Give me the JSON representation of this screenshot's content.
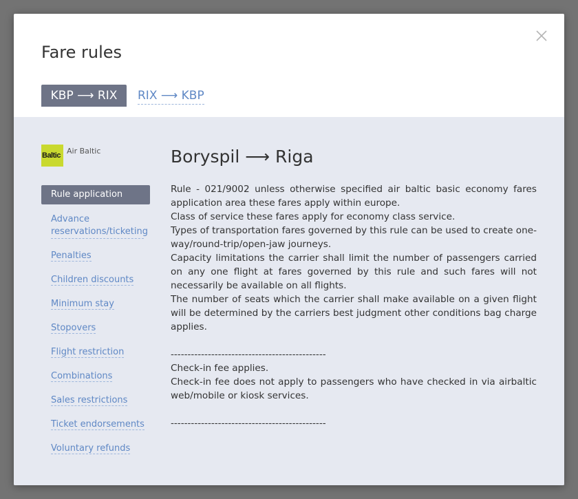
{
  "modal": {
    "title": "Fare rules",
    "close_icon": "close-icon"
  },
  "tabs": [
    {
      "label": "KBP ⟶ RIX",
      "active": true
    },
    {
      "label": "RIX ⟶ KBP",
      "active": false
    }
  ],
  "airline": {
    "logo_text": "Baltic",
    "name": "Air Baltic",
    "logo_color": "#c9d92f"
  },
  "rule_menu": [
    {
      "label": "Rule application",
      "active": true
    },
    {
      "label": "Advance reservations/ticketing"
    },
    {
      "label": "Penalties"
    },
    {
      "label": "Children discounts"
    },
    {
      "label": "Minimum stay"
    },
    {
      "label": "Stopovers"
    },
    {
      "label": "Flight restriction"
    },
    {
      "label": "Combinations"
    },
    {
      "label": "Sales restrictions"
    },
    {
      "label": "Ticket endorsements"
    },
    {
      "label": "Voluntary refunds"
    }
  ],
  "route_title": "Boryspil ⟶ Riga",
  "rule_lines": [
    "Rule - 021/9002 unless otherwise specified air baltic basic economy fares application area these fares apply within europe.",
    "Class of service these fares apply for economy class service.",
    "Types of transportation fares governed by this rule can be used to create one-way/round-trip/open-jaw journeys.",
    "Capacity limitations the carrier shall limit the number of passengers carried on any one flight at fares governed by this rule and such fares will not necessarily be available on all flights.",
    "The number of seats which the carrier shall make available on a given flight will be determined by the carriers best judgment other conditions bag charge applies.",
    "",
    "----------------------------------------------",
    "Check-in fee applies.",
    "Check-in fee does not apply to passengers who have checked in via airbaltic web/mobile or kiosk services.",
    "",
    "----------------------------------------------"
  ],
  "colors": {
    "accent": "#6e7487",
    "link": "#5f88c5",
    "content_bg": "#e6e9f1"
  }
}
